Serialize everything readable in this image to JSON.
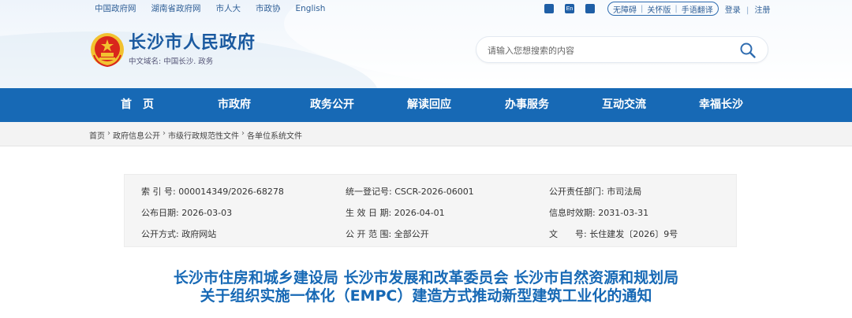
{
  "top_links": [
    "中国政府网",
    "湖南省政府网",
    "市人大",
    "市政协",
    "English"
  ],
  "utility": {
    "icon_labels": [
      "",
      "En",
      ""
    ],
    "pill": [
      "无障碍",
      "关怀版",
      "手语翻译"
    ],
    "account": [
      "登录",
      "注册"
    ]
  },
  "logo": {
    "title": "长沙市人民政府",
    "subtitle": "中文域名: 中国长沙. 政务"
  },
  "search": {
    "placeholder": "请输入您想搜索的内容"
  },
  "nav": [
    "首　页",
    "市政府",
    "政务公开",
    "解读回应",
    "办事服务",
    "互动交流",
    "幸福长沙"
  ],
  "breadcrumb": [
    "首页",
    "政府信息公开",
    "市级行政规范性文件",
    "各单位系统文件"
  ],
  "meta": {
    "index_label": "索 引 号:",
    "index_value": "000014349/2026-68278",
    "code_label": "统一登记号:",
    "code_value": "CSCR-2026-06001",
    "dept_label": "公开责任部门:",
    "dept_value": "市司法局",
    "pub_label": "公布日期:",
    "pub_value": "2026-03-03",
    "eff_label": "生 效 日 期:",
    "eff_value": "2026-04-01",
    "exp_label": "信息时效期:",
    "exp_value": "2031-03-31",
    "mode_label": "公开方式:",
    "mode_value": "政府网站",
    "scope_label": "公 开 范 围:",
    "scope_value": "全部公开",
    "doc_label": "文　　号:",
    "doc_value": "长住建发〔2026〕9号"
  },
  "title": {
    "line1": "长沙市住房和城乡建设局 长沙市发展和改革委员会 长沙市自然资源和规划局",
    "line2": "关于组织实施一体化（EMPC）建造方式推动新型建筑工业化的通知"
  },
  "colors": {
    "brand_blue": "#1769b5",
    "logo_blue": "#1b5aa0",
    "emblem_red": "#d9261c",
    "emblem_gold": "#f2c230"
  }
}
